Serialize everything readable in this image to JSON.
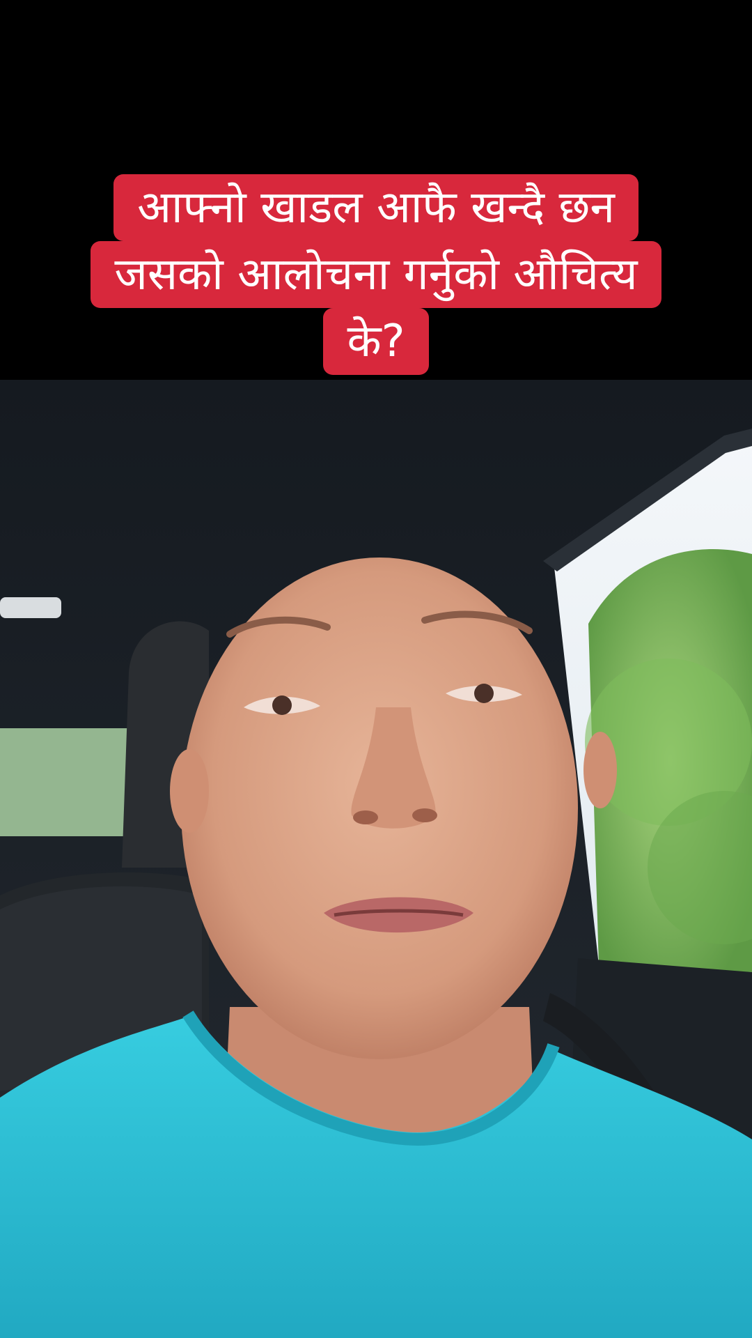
{
  "caption": {
    "lines": [
      "आफ्नो खाडल आफै खन्दै छन",
      "जसको आलोचना गर्नुको औचित्य",
      "के?"
    ],
    "background_color": "#d8283c",
    "text_color": "#ffffff"
  },
  "scene": {
    "subject": "man-speaking-to-camera-in-car",
    "shirt_color": "#2ec3d6",
    "foliage_color": "#8cc46a",
    "interior_color": "#1f2328"
  }
}
